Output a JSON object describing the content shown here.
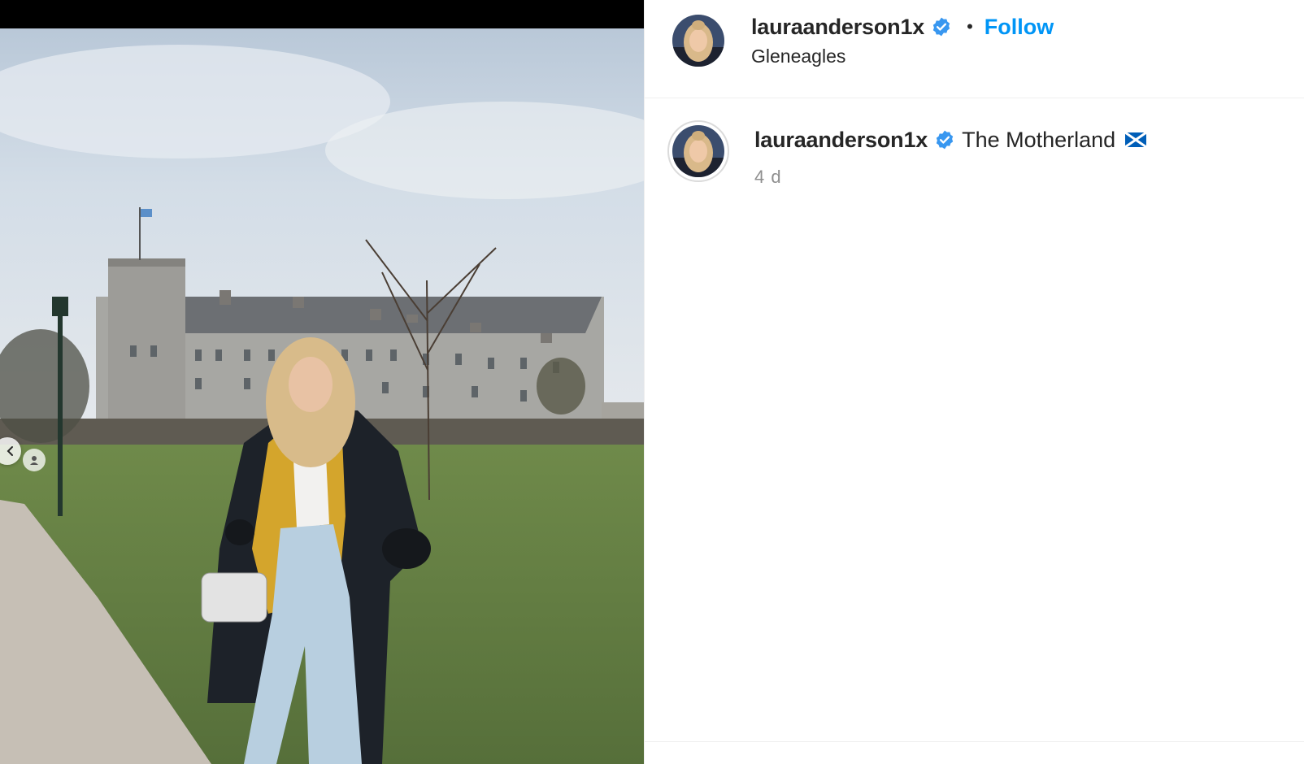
{
  "post": {
    "username": "lauraanderson1x",
    "verified": true,
    "separator": "•",
    "follow_label": "Follow",
    "location": "Gleneagles"
  },
  "caption": {
    "username": "lauraanderson1x",
    "text": "The Motherland",
    "emoji": "scotland-flag-icon",
    "timestamp": "4 d"
  },
  "icons": {
    "verified": "verified-badge-icon",
    "prev": "chevron-left-icon"
  },
  "colors": {
    "follow_blue": "#0095f6",
    "verified_blue": "#3897f0",
    "muted_text": "#8e8e8e",
    "divider": "#efefef"
  }
}
